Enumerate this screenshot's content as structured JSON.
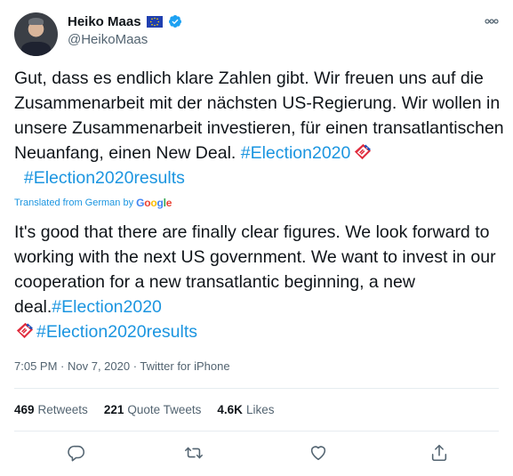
{
  "author": {
    "name": "Heiko Maas",
    "handle": "@HeikoMaas",
    "verified": true,
    "flag": "eu-flag-icon"
  },
  "more_label": "ooo",
  "tweet": {
    "de_text_plain": "Gut, dass es endlich klare Zahlen gibt. Wir freuen uns auf die Zusammenarbeit mit der nächsten US-Regierung. Wir wollen in unsere Zusammenarbeit investieren, für einen transatlantischen Neuanfang, einen New Deal. ",
    "de_hashtag_1": "#Election2020",
    "de_hashtag_2": "#Election2020results",
    "translated_prefix": "Translated from German by",
    "translated_google": [
      "G",
      "o",
      "o",
      "g",
      "l",
      "e"
    ],
    "en_text_plain": "It's good that there are finally clear figures. We look forward to working with the next US government. We want to invest in our cooperation for a new transatlantic beginning, a new deal.",
    "en_hashtag_1": "#Election2020",
    "en_hashtag_2": "#Election2020results"
  },
  "meta": {
    "time": "7:05 PM",
    "sep1": " · ",
    "date": "Nov 7, 2020",
    "sep2": " · ",
    "source": "Twitter for iPhone"
  },
  "stats": {
    "retweets_count": "469",
    "retweets_label": "Retweets",
    "quotes_count": "221",
    "quotes_label": "Quote Tweets",
    "likes_count": "4.6K",
    "likes_label": "Likes"
  },
  "actions": [
    "reply-icon",
    "retweet-icon",
    "like-icon",
    "share-icon"
  ],
  "colors": {
    "hashtag": "#1b95e0",
    "secondary": "#536471",
    "verified": "#1da1f2",
    "divider": "#e6ecf0"
  }
}
